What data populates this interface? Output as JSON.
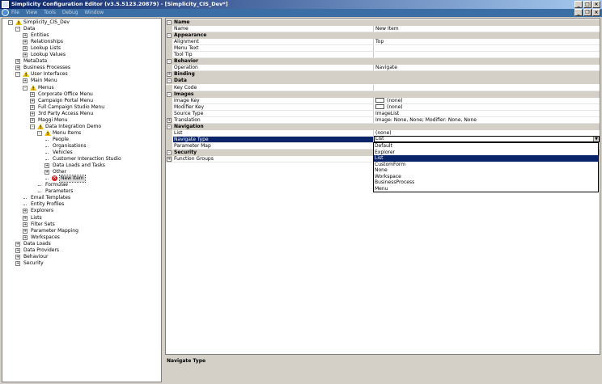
{
  "window": {
    "title": "Simplicity Configuration Editor (v3.5.5123.20879) - [Simplicity_CIS_Dev*]"
  },
  "menu": [
    "File",
    "View",
    "Tools",
    "Debug",
    "Window"
  ],
  "tree": [
    {
      "label": "Simplicity_CIS_Dev",
      "level": 0,
      "exp": "-",
      "icon": "warning"
    },
    {
      "label": "Data",
      "level": 1,
      "exp": "-"
    },
    {
      "label": "Entities",
      "level": 2,
      "exp": "+"
    },
    {
      "label": "Relationships",
      "level": 2,
      "exp": "+"
    },
    {
      "label": "Lookup Lists",
      "level": 2,
      "exp": "+"
    },
    {
      "label": "Lookup Values",
      "level": 2,
      "exp": "+"
    },
    {
      "label": "MetaData",
      "level": 1,
      "exp": "+"
    },
    {
      "label": "Business Processes",
      "level": 1,
      "exp": "+"
    },
    {
      "label": "User Interfaces",
      "level": 1,
      "exp": "-",
      "icon": "warning"
    },
    {
      "label": "Main Menu",
      "level": 2,
      "exp": "+"
    },
    {
      "label": "Menus",
      "level": 2,
      "exp": "-",
      "icon": "warning"
    },
    {
      "label": "Corporate Office Menu",
      "level": 3,
      "exp": "+"
    },
    {
      "label": "Campaign Portal Menu",
      "level": 3,
      "exp": "+"
    },
    {
      "label": "Full Campaign Studio Menu",
      "level": 3,
      "exp": "+"
    },
    {
      "label": "3rd Party Access Menu",
      "level": 3,
      "exp": "+"
    },
    {
      "label": "Maggi Menu",
      "level": 3,
      "exp": "+"
    },
    {
      "label": "Data Integration Demo",
      "level": 3,
      "exp": "-",
      "icon": "warning"
    },
    {
      "label": "Menu Items",
      "level": 4,
      "exp": "-",
      "icon": "warning"
    },
    {
      "label": "People",
      "level": 5
    },
    {
      "label": "Organisations",
      "level": 5
    },
    {
      "label": "Vehicles",
      "level": 5
    },
    {
      "label": "Customer Interaction Studio",
      "level": 5
    },
    {
      "label": "Data Loads and Tasks",
      "level": 5,
      "exp": "+"
    },
    {
      "label": "Other",
      "level": 5,
      "exp": "+"
    },
    {
      "label": "New Item",
      "level": 5,
      "icon": "error",
      "selected": true
    },
    {
      "label": "Formulae",
      "level": 4
    },
    {
      "label": "Parameters",
      "level": 4
    },
    {
      "label": "Email Templates",
      "level": 2
    },
    {
      "label": "Entity Profiles",
      "level": 2
    },
    {
      "label": "Explorers",
      "level": 2,
      "exp": "+"
    },
    {
      "label": "Lists",
      "level": 2,
      "exp": "+"
    },
    {
      "label": "Filter Sets",
      "level": 2,
      "exp": "+"
    },
    {
      "label": "Parameter Mapping",
      "level": 2,
      "exp": "+"
    },
    {
      "label": "Workspaces",
      "level": 2,
      "exp": "+"
    },
    {
      "label": "Data Loads",
      "level": 1,
      "exp": "+"
    },
    {
      "label": "Data Providers",
      "level": 1,
      "exp": "+"
    },
    {
      "label": "Behaviour",
      "level": 1,
      "exp": "+"
    },
    {
      "label": "Security",
      "level": 1,
      "exp": "+"
    }
  ],
  "grid": [
    {
      "cat": true,
      "name": "Name"
    },
    {
      "name": "Name",
      "value": "New Item"
    },
    {
      "cat": true,
      "name": "Appearance"
    },
    {
      "name": "Alignment",
      "value": "Top"
    },
    {
      "name": "Menu Text",
      "value": ""
    },
    {
      "name": "Tool Tip",
      "value": ""
    },
    {
      "cat": true,
      "name": "Behavior"
    },
    {
      "name": "Operation",
      "value": "Navigate"
    },
    {
      "cat": true,
      "name": "Binding",
      "exp": "+"
    },
    {
      "cat": true,
      "name": "Data"
    },
    {
      "name": "Key Code",
      "value": ""
    },
    {
      "cat": true,
      "name": "Images"
    },
    {
      "name": "Image Key",
      "value": "(none)",
      "swatch": true
    },
    {
      "name": "Modifier Key",
      "value": "(none)",
      "swatch": true
    },
    {
      "name": "Source Type",
      "value": "ImageList"
    },
    {
      "name": "Translation",
      "value": "Image: None, None; Modifier: None, None",
      "exp": "+"
    },
    {
      "cat": true,
      "name": "Navigation"
    },
    {
      "name": "List",
      "value": "(none)"
    },
    {
      "name": "Navigate Type",
      "value": "",
      "selected": true
    },
    {
      "name": "Parameter Map",
      "value": ""
    },
    {
      "cat": true,
      "name": "Security"
    },
    {
      "name": "Function Groups",
      "value": "",
      "exp": "+"
    }
  ],
  "dropdown": {
    "value": "List",
    "options": [
      "Default",
      "Explorer",
      "List",
      "CustomForm",
      "None",
      "Workspace",
      "BusinessProcess",
      "Menu"
    ],
    "highlighted": "List"
  },
  "description": {
    "title": "Navigate Type"
  }
}
